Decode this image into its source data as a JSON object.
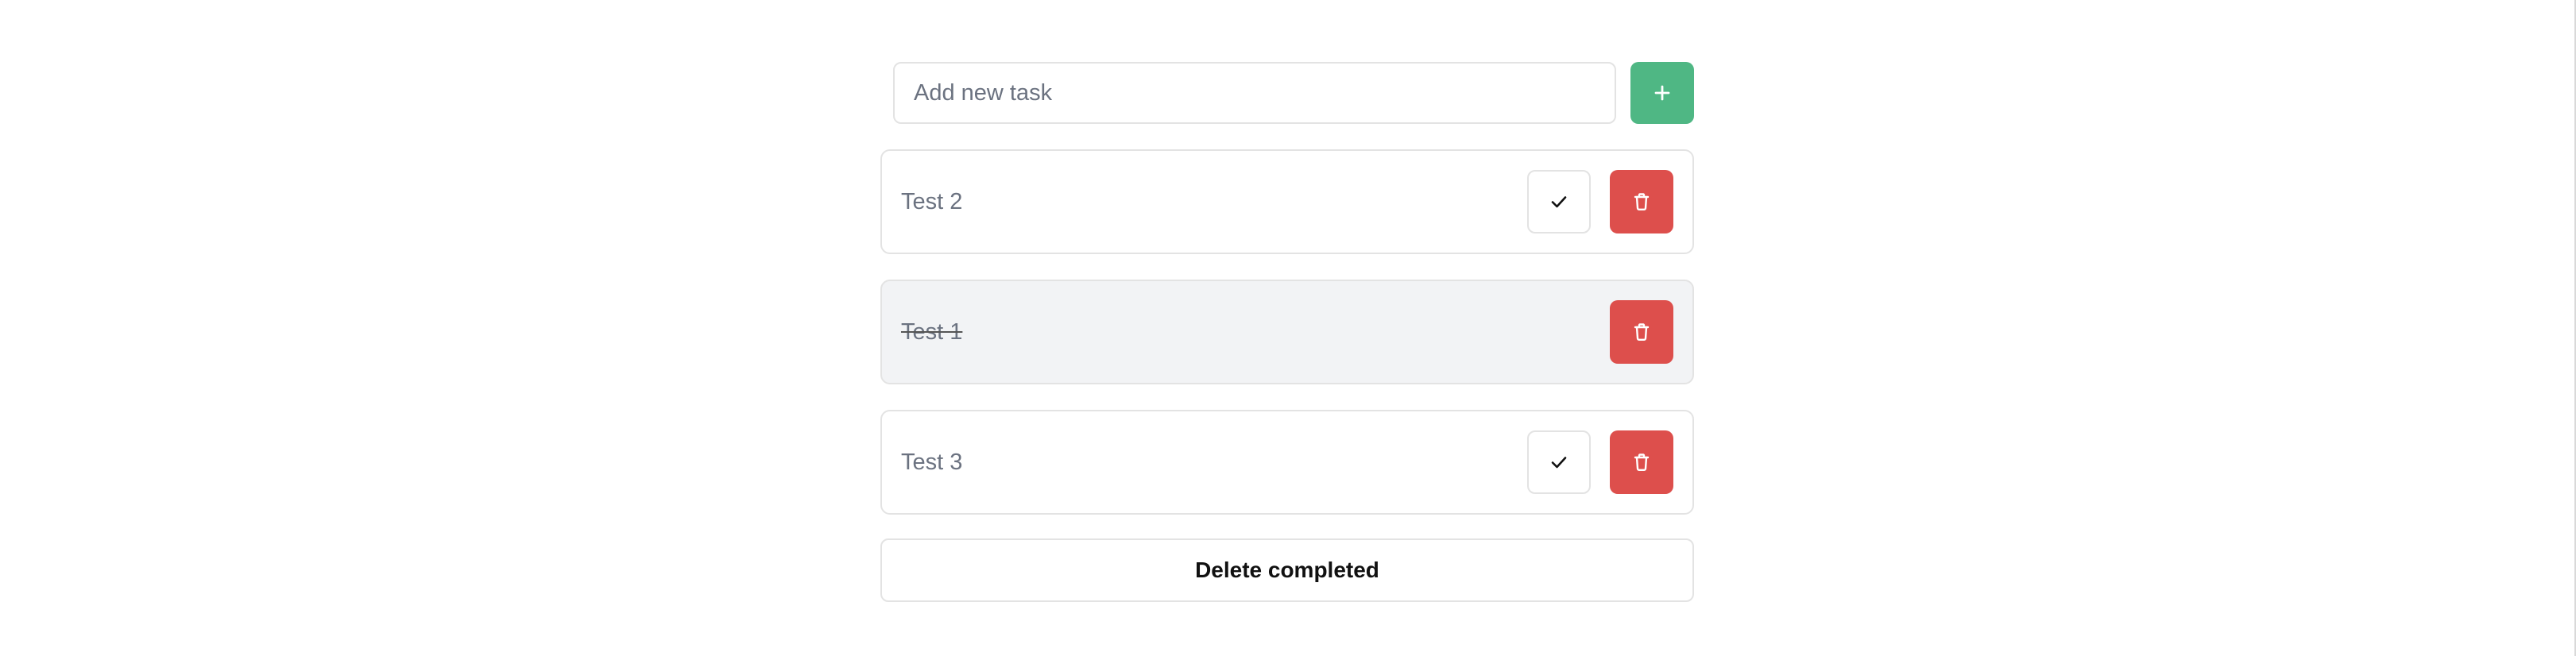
{
  "add_task": {
    "placeholder": "Add new task",
    "value": "",
    "add_icon": "plus-icon"
  },
  "tasks": [
    {
      "label": "Test 2",
      "completed": false
    },
    {
      "label": "Test 1",
      "completed": true
    },
    {
      "label": "Test 3",
      "completed": false
    }
  ],
  "actions": {
    "delete_completed_label": "Delete completed"
  },
  "icons": {
    "complete": "check-icon",
    "delete": "trash-icon"
  },
  "colors": {
    "add_button": "#4fb784",
    "delete_button": "#dd4f4c",
    "completed_task_background": "#f2f3f5"
  }
}
